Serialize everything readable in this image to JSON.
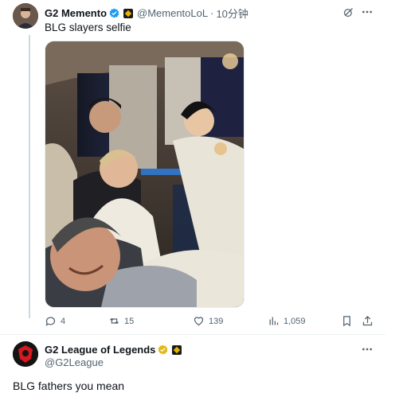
{
  "tweet1": {
    "display_name": "G2 Memento",
    "handle": "@MementoLoL",
    "separator": "·",
    "time": "10分钟",
    "text": "BLG slayers selfie",
    "stats": {
      "replies": "4",
      "retweets": "15",
      "likes": "139",
      "views": "1,059"
    }
  },
  "tweet2": {
    "display_name": "G2 League of Legends",
    "handle": "@G2League",
    "text": "BLG fathers you mean"
  },
  "colors": {
    "verified_blue": "#1d9bf0",
    "verified_gold": "#e2b719",
    "muted": "#536471",
    "g2_red": "#d7181e"
  }
}
